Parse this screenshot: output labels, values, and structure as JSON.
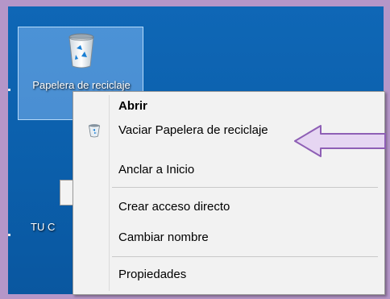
{
  "desktop": {
    "recycle_bin_label": "Papelera de reciclaje",
    "icon2_label": "TU C"
  },
  "context_menu": {
    "items": [
      {
        "label": "Abrir",
        "bold": true
      },
      {
        "label": "Vaciar Papelera de reciclaje",
        "icon": "recycle-bin-small-icon"
      },
      {
        "label": "Anclar a Inicio"
      },
      {
        "label": "Crear acceso directo"
      },
      {
        "label": "Cambiar nombre"
      },
      {
        "label": "Propiedades"
      }
    ]
  },
  "colors": {
    "frame": "#b596c8",
    "desktop": "#0b5fab",
    "menu_bg": "#f2f2f2",
    "arrow_fill": "#e6d6f2",
    "arrow_stroke": "#8e5fb5"
  },
  "annotation": {
    "icon": "left-pointing-arrow-icon"
  }
}
